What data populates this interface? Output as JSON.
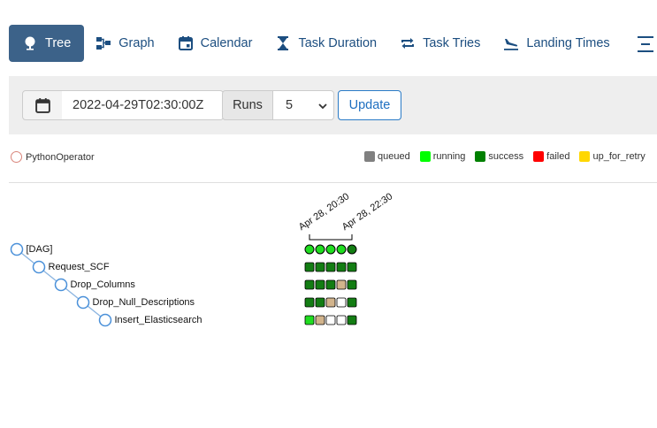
{
  "nav": {
    "items": [
      {
        "label": "Tree",
        "icon": "tree-icon",
        "active": true
      },
      {
        "label": "Graph",
        "icon": "graph-icon",
        "active": false
      },
      {
        "label": "Calendar",
        "icon": "calendar-icon",
        "active": false
      },
      {
        "label": "Task Duration",
        "icon": "hourglass-icon",
        "active": false
      },
      {
        "label": "Task Tries",
        "icon": "retry-arrows-icon",
        "active": false
      },
      {
        "label": "Landing Times",
        "icon": "plane-landing-icon",
        "active": false
      }
    ],
    "more_icon": "menu-icon"
  },
  "toolbar": {
    "base_date": "2022-04-29T02:30:00Z",
    "runs_label": "Runs",
    "runs_value": "5",
    "update_label": "Update"
  },
  "legend": {
    "operator": "PythonOperator",
    "states": [
      {
        "label": "queued",
        "color": "#808080"
      },
      {
        "label": "running",
        "color": "#00ff00"
      },
      {
        "label": "success",
        "color": "#008000"
      },
      {
        "label": "failed",
        "color": "#ff0000"
      },
      {
        "label": "up_for_retry",
        "color": "#ffd700"
      }
    ]
  },
  "colors": {
    "nav_active_bg": "#3c6289",
    "link": "#1c4e80",
    "node_stroke": "#4a90d9",
    "success": "#137d13",
    "running_light": "#20dd20",
    "removed_tan": "#d2b48c",
    "none_white": "#ffffff"
  },
  "tree": {
    "run_dates": [
      "Apr 28, 20:30",
      "Apr 28, 22:30"
    ],
    "tasks": [
      {
        "label": "[DAG]",
        "depth": 0,
        "states": [
          "running",
          "running",
          "running",
          "running",
          "success"
        ]
      },
      {
        "label": "Request_SCF",
        "depth": 1,
        "states": [
          "success",
          "success",
          "success",
          "success",
          "success"
        ]
      },
      {
        "label": "Drop_Columns",
        "depth": 2,
        "states": [
          "success",
          "success",
          "success",
          "removed",
          "success"
        ]
      },
      {
        "label": "Drop_Null_Descriptions",
        "depth": 3,
        "states": [
          "success",
          "success",
          "removed",
          "none",
          "success"
        ]
      },
      {
        "label": "Insert_Elasticsearch",
        "depth": 4,
        "states": [
          "running",
          "removed",
          "none",
          "none",
          "success"
        ]
      }
    ]
  }
}
